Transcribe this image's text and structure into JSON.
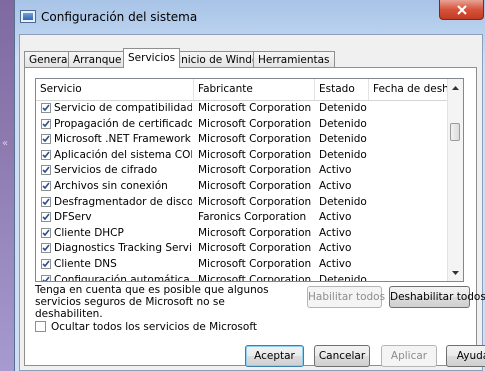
{
  "window": {
    "title": "Configuración del sistema"
  },
  "tabs": [
    "General",
    "Arranque",
    "Servicios",
    "Inicio de Windows",
    "Herramientas"
  ],
  "active_tab": "Servicios",
  "table": {
    "headers": [
      "Servicio",
      "Fabricante",
      "Estado",
      "Fecha de desha..."
    ],
    "rows": [
      {
        "checked": true,
        "service": "Servicio de compatibilidad con Bl...",
        "maker": "Microsoft Corporation",
        "status": "Detenido"
      },
      {
        "checked": true,
        "service": "Propagación de certificados",
        "maker": "Microsoft Corporation",
        "status": "Detenido"
      },
      {
        "checked": true,
        "service": "Microsoft .NET Framework NGEN...",
        "maker": "Microsoft Corporation",
        "status": "Detenido"
      },
      {
        "checked": true,
        "service": "Aplicación del sistema COM+",
        "maker": "Microsoft Corporation",
        "status": "Detenido"
      },
      {
        "checked": true,
        "service": "Servicios de cifrado",
        "maker": "Microsoft Corporation",
        "status": "Activo"
      },
      {
        "checked": true,
        "service": "Archivos sin conexión",
        "maker": "Microsoft Corporation",
        "status": "Activo"
      },
      {
        "checked": true,
        "service": "Desfragmentador de disco",
        "maker": "Microsoft Corporation",
        "status": "Detenido"
      },
      {
        "checked": true,
        "service": "DFServ",
        "maker": "Faronics Corporation",
        "status": "Activo"
      },
      {
        "checked": true,
        "service": "Cliente DHCP",
        "maker": "Microsoft Corporation",
        "status": "Activo"
      },
      {
        "checked": true,
        "service": "Diagnostics Tracking Service",
        "maker": "Microsoft Corporation",
        "status": "Activo"
      },
      {
        "checked": true,
        "service": "Cliente DNS",
        "maker": "Microsoft Corporation",
        "status": "Activo"
      },
      {
        "checked": true,
        "service": "Configuración automática de red...",
        "maker": "Microsoft Corporation",
        "status": "Detenido"
      }
    ]
  },
  "note": "Tenga en cuenta que es posible que algunos servicios seguros de Microsoft no se deshabiliten.",
  "buttons": {
    "enable_all": "Habilitar todos",
    "disable_all": "Deshabilitar todos",
    "ok": "Aceptar",
    "cancel": "Cancelar",
    "apply": "Aplicar",
    "help": "Ayuda"
  },
  "hide_ms_label": "Ocultar todos los servicios de Microsoft",
  "hide_ms_checked": false,
  "colors": {
    "close_button": "#c23a22",
    "title_gradient": "#a7c3e6"
  },
  "icons": {
    "close": "close-icon",
    "app": "system-config-icon",
    "check": "checkmark-icon"
  }
}
